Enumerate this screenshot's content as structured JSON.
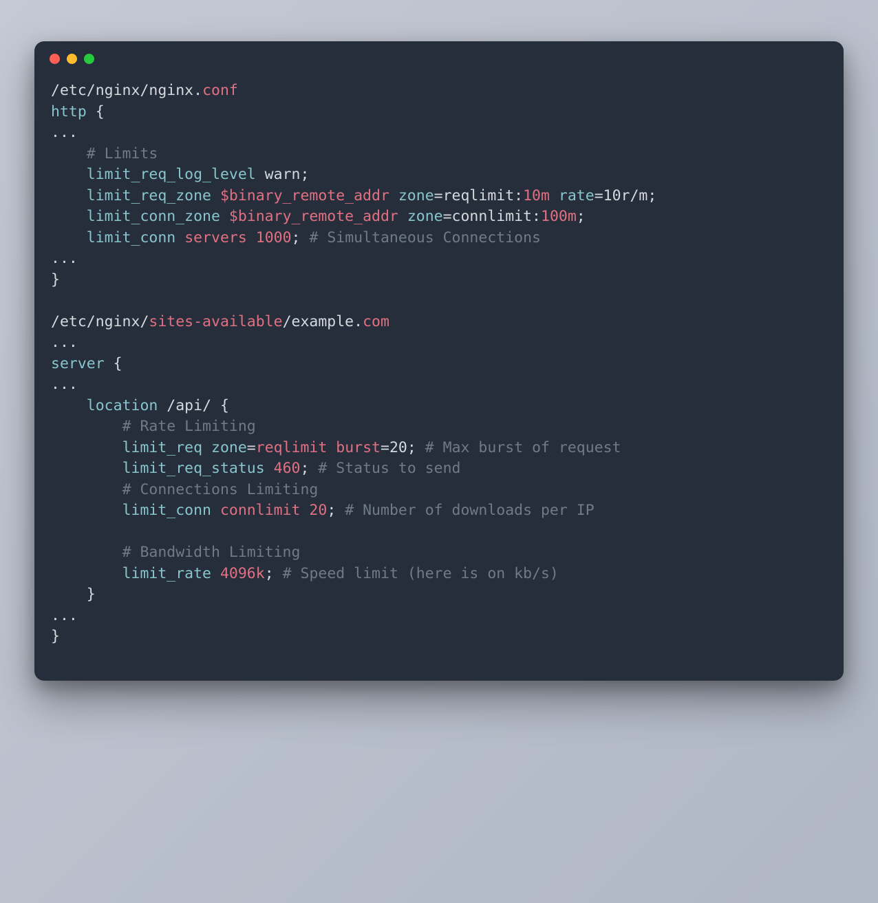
{
  "colors": {
    "bg": "#252e3a",
    "plain": "#d6dae0",
    "keyword": "#e27082",
    "directive": "#88c5cc",
    "comment": "#707a88",
    "dot_red": "#ff5f56",
    "dot_yellow": "#ffbd2e",
    "dot_green": "#27c93f"
  },
  "window_controls": [
    "close",
    "minimize",
    "zoom"
  ],
  "code": {
    "lines": [
      [
        {
          "cls": "plain",
          "txt": "/etc/nginx/nginx"
        },
        {
          "cls": "punct",
          "txt": "."
        },
        {
          "cls": "keyword",
          "txt": "conf"
        }
      ],
      [
        {
          "cls": "dir",
          "txt": "http"
        },
        {
          "cls": "plain",
          "txt": " "
        },
        {
          "cls": "punct",
          "txt": "{"
        }
      ],
      [
        {
          "cls": "punct",
          "txt": "..."
        }
      ],
      [
        {
          "cls": "plain",
          "txt": "    "
        },
        {
          "cls": "comment",
          "txt": "# Limits"
        }
      ],
      [
        {
          "cls": "plain",
          "txt": "    "
        },
        {
          "cls": "dir",
          "txt": "limit_req_log_level"
        },
        {
          "cls": "plain",
          "txt": " warn"
        },
        {
          "cls": "punct",
          "txt": ";"
        }
      ],
      [
        {
          "cls": "plain",
          "txt": "    "
        },
        {
          "cls": "dir",
          "txt": "limit_req_zone"
        },
        {
          "cls": "plain",
          "txt": " "
        },
        {
          "cls": "var",
          "txt": "$binary_remote_addr"
        },
        {
          "cls": "plain",
          "txt": " "
        },
        {
          "cls": "dir",
          "txt": "zone"
        },
        {
          "cls": "punct",
          "txt": "="
        },
        {
          "cls": "plain",
          "txt": "reqlimit"
        },
        {
          "cls": "punct",
          "txt": ":"
        },
        {
          "cls": "num",
          "txt": "10m"
        },
        {
          "cls": "plain",
          "txt": " "
        },
        {
          "cls": "dir",
          "txt": "rate"
        },
        {
          "cls": "punct",
          "txt": "="
        },
        {
          "cls": "plain",
          "txt": "10r/m"
        },
        {
          "cls": "punct",
          "txt": ";"
        }
      ],
      [
        {
          "cls": "plain",
          "txt": "    "
        },
        {
          "cls": "dir",
          "txt": "limit_conn_zone"
        },
        {
          "cls": "plain",
          "txt": " "
        },
        {
          "cls": "var",
          "txt": "$binary_remote_addr"
        },
        {
          "cls": "plain",
          "txt": " "
        },
        {
          "cls": "dir",
          "txt": "zone"
        },
        {
          "cls": "punct",
          "txt": "="
        },
        {
          "cls": "plain",
          "txt": "connlimit"
        },
        {
          "cls": "punct",
          "txt": ":"
        },
        {
          "cls": "num",
          "txt": "100m"
        },
        {
          "cls": "punct",
          "txt": ";"
        }
      ],
      [
        {
          "cls": "plain",
          "txt": "    "
        },
        {
          "cls": "dir",
          "txt": "limit_conn"
        },
        {
          "cls": "plain",
          "txt": " "
        },
        {
          "cls": "keyword",
          "txt": "servers"
        },
        {
          "cls": "plain",
          "txt": " "
        },
        {
          "cls": "num",
          "txt": "1000"
        },
        {
          "cls": "punct",
          "txt": ";"
        },
        {
          "cls": "plain",
          "txt": " "
        },
        {
          "cls": "comment",
          "txt": "# Simultaneous Connections"
        }
      ],
      [
        {
          "cls": "punct",
          "txt": "..."
        }
      ],
      [
        {
          "cls": "punct",
          "txt": "}"
        }
      ],
      [
        {
          "cls": "plain",
          "txt": ""
        }
      ],
      [
        {
          "cls": "plain",
          "txt": "/etc/nginx/"
        },
        {
          "cls": "keyword",
          "txt": "sites-available"
        },
        {
          "cls": "plain",
          "txt": "/example"
        },
        {
          "cls": "punct",
          "txt": "."
        },
        {
          "cls": "keyword",
          "txt": "com"
        }
      ],
      [
        {
          "cls": "punct",
          "txt": "..."
        }
      ],
      [
        {
          "cls": "dir",
          "txt": "server"
        },
        {
          "cls": "plain",
          "txt": " "
        },
        {
          "cls": "punct",
          "txt": "{"
        }
      ],
      [
        {
          "cls": "punct",
          "txt": "..."
        }
      ],
      [
        {
          "cls": "plain",
          "txt": "    "
        },
        {
          "cls": "dir",
          "txt": "location"
        },
        {
          "cls": "plain",
          "txt": " /api/ "
        },
        {
          "cls": "punct",
          "txt": "{"
        }
      ],
      [
        {
          "cls": "plain",
          "txt": "        "
        },
        {
          "cls": "comment",
          "txt": "# Rate Limiting"
        }
      ],
      [
        {
          "cls": "plain",
          "txt": "        "
        },
        {
          "cls": "dir",
          "txt": "limit_req"
        },
        {
          "cls": "plain",
          "txt": " "
        },
        {
          "cls": "dir",
          "txt": "zone"
        },
        {
          "cls": "punct",
          "txt": "="
        },
        {
          "cls": "keyword",
          "txt": "reqlimit"
        },
        {
          "cls": "plain",
          "txt": " "
        },
        {
          "cls": "keyword",
          "txt": "burst"
        },
        {
          "cls": "punct",
          "txt": "="
        },
        {
          "cls": "plain",
          "txt": "20"
        },
        {
          "cls": "punct",
          "txt": ";"
        },
        {
          "cls": "plain",
          "txt": " "
        },
        {
          "cls": "comment",
          "txt": "# Max burst of request"
        }
      ],
      [
        {
          "cls": "plain",
          "txt": "        "
        },
        {
          "cls": "dir",
          "txt": "limit_req_status"
        },
        {
          "cls": "plain",
          "txt": " "
        },
        {
          "cls": "num",
          "txt": "460"
        },
        {
          "cls": "punct",
          "txt": ";"
        },
        {
          "cls": "plain",
          "txt": " "
        },
        {
          "cls": "comment",
          "txt": "# Status to send"
        }
      ],
      [
        {
          "cls": "plain",
          "txt": "        "
        },
        {
          "cls": "comment",
          "txt": "# Connections Limiting"
        }
      ],
      [
        {
          "cls": "plain",
          "txt": "        "
        },
        {
          "cls": "dir",
          "txt": "limit_conn"
        },
        {
          "cls": "plain",
          "txt": " "
        },
        {
          "cls": "keyword",
          "txt": "connlimit"
        },
        {
          "cls": "plain",
          "txt": " "
        },
        {
          "cls": "num",
          "txt": "20"
        },
        {
          "cls": "punct",
          "txt": ";"
        },
        {
          "cls": "plain",
          "txt": " "
        },
        {
          "cls": "comment",
          "txt": "# Number of downloads per IP"
        }
      ],
      [
        {
          "cls": "plain",
          "txt": ""
        }
      ],
      [
        {
          "cls": "plain",
          "txt": "        "
        },
        {
          "cls": "comment",
          "txt": "# Bandwidth Limiting"
        }
      ],
      [
        {
          "cls": "plain",
          "txt": "        "
        },
        {
          "cls": "dir",
          "txt": "limit_rate"
        },
        {
          "cls": "plain",
          "txt": " "
        },
        {
          "cls": "num",
          "txt": "4096k"
        },
        {
          "cls": "punct",
          "txt": ";"
        },
        {
          "cls": "plain",
          "txt": " "
        },
        {
          "cls": "comment",
          "txt": "# Speed limit (here is on kb/s)"
        }
      ],
      [
        {
          "cls": "plain",
          "txt": "    "
        },
        {
          "cls": "punct",
          "txt": "}"
        }
      ],
      [
        {
          "cls": "punct",
          "txt": "..."
        }
      ],
      [
        {
          "cls": "punct",
          "txt": "}"
        }
      ]
    ]
  }
}
